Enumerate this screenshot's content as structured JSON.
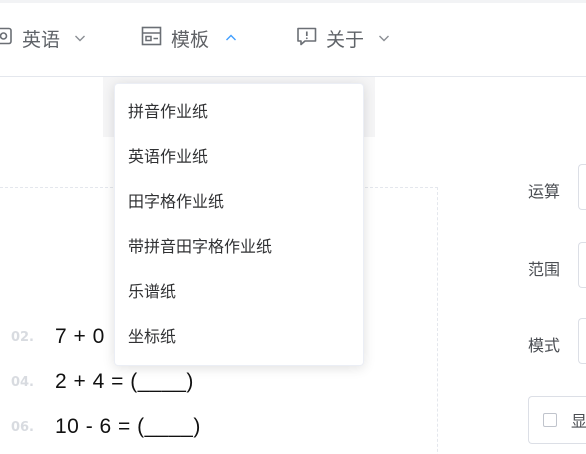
{
  "nav": {
    "items": [
      {
        "label": "英语",
        "icon": "translate-icon",
        "caret": "chevron-down"
      },
      {
        "label": "模板",
        "icon": "template-icon",
        "caret": "chevron-up"
      },
      {
        "label": "关于",
        "icon": "about-icon",
        "caret": "chevron-down"
      }
    ]
  },
  "dropdown": {
    "items": [
      "拼音作业纸",
      "英语作业纸",
      "田字格作业纸",
      "带拼音田字格作业纸",
      "乐谱纸",
      "坐标纸"
    ]
  },
  "questions": [
    {
      "num": "02.",
      "expr": "7 + 0"
    },
    {
      "num": "04.",
      "expr": "2 + 4 = (____)"
    },
    {
      "num": "06.",
      "expr": "10 - 6 = (____)"
    }
  ],
  "form": {
    "op_label": "运算",
    "range_label": "范围",
    "mode_label": "模式",
    "checkbox_label": "显"
  },
  "colors": {
    "accent": "#409eff",
    "text": "#303133",
    "muted": "#d8dbe0"
  }
}
